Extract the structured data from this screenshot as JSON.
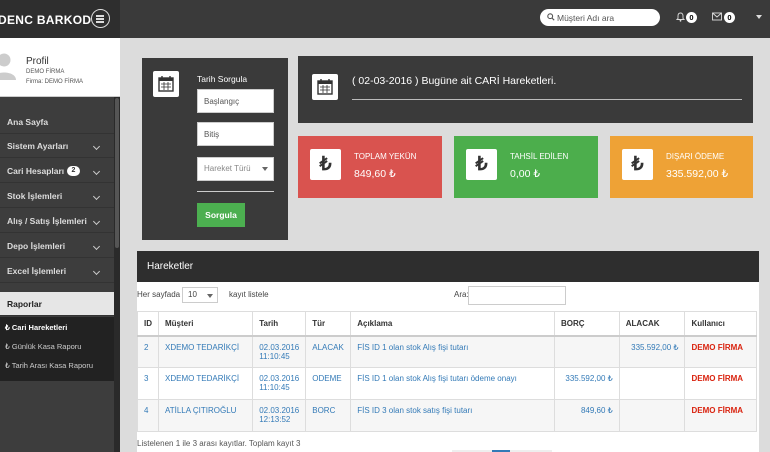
{
  "brand": "DENC BARKOD",
  "topbar": {
    "search_placeholder": "Müşteri Adı ara",
    "notifications_count": "0",
    "messages_count": "0"
  },
  "profile": {
    "name": "Profil",
    "user": "DEMO FİRMA",
    "company": "Firma: DEMO FİRMA"
  },
  "sidebar": {
    "items": [
      {
        "label": "Ana Sayfa"
      },
      {
        "label": "Sistem Ayarları"
      },
      {
        "label": "Cari Hesapları",
        "count": "2"
      },
      {
        "label": "Stok İşlemleri"
      },
      {
        "label": "Alış / Satış İşlemleri"
      },
      {
        "label": "Depo İşlemleri"
      },
      {
        "label": "Excel İşlemleri"
      },
      {
        "label": "Raporlar"
      }
    ],
    "submenu": [
      {
        "label": "₺ Cari Hareketleri",
        "active": true
      },
      {
        "label": "₺ Günlük Kasa Raporu",
        "active": false
      },
      {
        "label": "₺ Tarih Arası Kasa Raporu",
        "active": false
      }
    ]
  },
  "query": {
    "title": "Tarih Sorgula",
    "start_placeholder": "Başlangıç",
    "end_placeholder": "Bitiş",
    "movement_type": "Hareket Türü",
    "button": "Sorgula"
  },
  "report": {
    "title": "( 02-03-2016 ) Bugüne ait CARİ Hareketleri."
  },
  "stats": [
    {
      "label": "TOPLAM YEKÜN",
      "value": "849,60 ₺",
      "color": "#d9534f"
    },
    {
      "label": "TAHSİL EDİLEN",
      "value": "0,00 ₺",
      "color": "#4cae4c"
    },
    {
      "label": "DIŞARI ÖDEME",
      "value": "335.592,00 ₺",
      "color": "#eea236"
    }
  ],
  "table": {
    "title": "Hareketler",
    "length_before": "Her sayfada",
    "length_value": "10",
    "length_after": "kayıt listele",
    "search_label": "Ara:",
    "columns": [
      "ID",
      "Müşteri",
      "Tarih",
      "Tür",
      "Açıklama",
      "BORÇ",
      "ALACAK",
      "Kullanıcı"
    ],
    "rows": [
      {
        "id": "2",
        "customer": "XDEMO TEDARİKÇİ",
        "date": "02.03.2016",
        "time": "11:10:45",
        "type": "ALACAK",
        "desc": "FİS ID 1 olan stok Alış fişi tutarı",
        "debt": "",
        "credit": "335.592,00 ₺",
        "user": "DEMO FİRMA"
      },
      {
        "id": "3",
        "customer": "XDEMO TEDARİKÇİ",
        "date": "02.03.2016",
        "time": "11:10:45",
        "type": "ODEME",
        "desc": "FİS ID 1 olan stok Alış fişi tutarı ödeme onayı",
        "debt": "335.592,00 ₺",
        "credit": "",
        "user": "DEMO FİRMA"
      },
      {
        "id": "4",
        "customer": "ATİLLA ÇITIROĞLU",
        "date": "02.03.2016",
        "time": "12:13:52",
        "type": "BORC",
        "desc": "FİS ID 3 olan stok satış fişi tutarı",
        "debt": "849,60 ₺",
        "credit": "",
        "user": "DEMO FİRMA"
      }
    ],
    "info": "Listelenen 1 ile 3 arası kayıtlar. Toplam kayıt 3"
  }
}
